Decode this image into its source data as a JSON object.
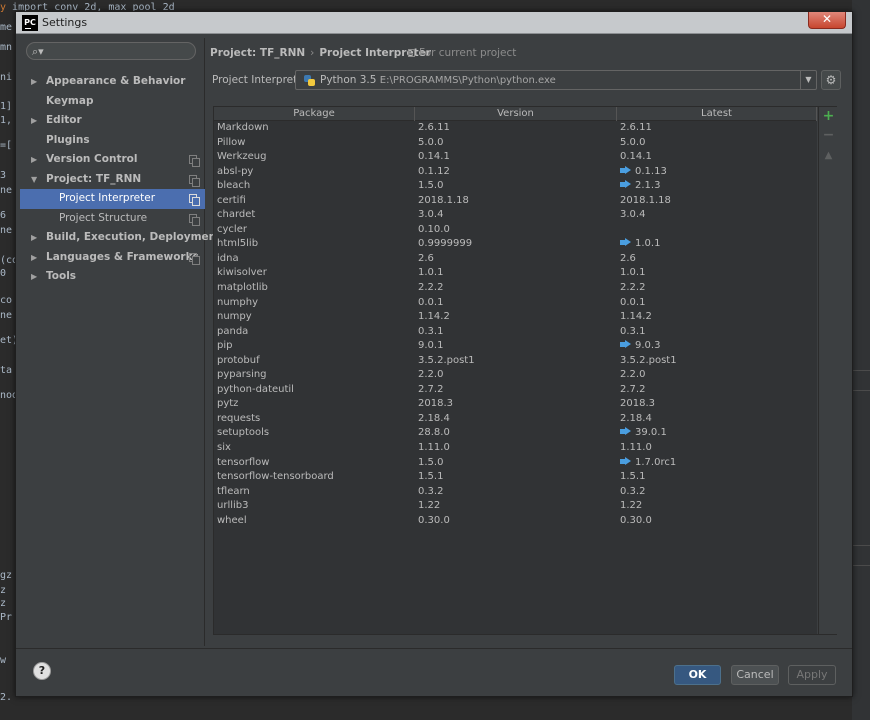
{
  "window": {
    "title": "Settings",
    "app_icon_text": "PC",
    "close_symbol": "✕"
  },
  "background_code": {
    "lines": [
      {
        "kw": "y",
        "rest": " import conv_2d, max_pool_2d"
      },
      {
        "kw": "",
        "rest": "me"
      },
      {
        "kw": "",
        "rest": "mn"
      },
      {
        "kw": "",
        "rest": "ni"
      },
      {
        "kw": "",
        "rest": "1]"
      },
      {
        "kw": "",
        "rest": "1,"
      },
      {
        "kw": "",
        "rest": "=["
      },
      {
        "kw": "",
        "rest": "3"
      },
      {
        "kw": "",
        "rest": "ne"
      },
      {
        "kw": "",
        "rest": "6"
      },
      {
        "kw": "",
        "rest": "ne"
      },
      {
        "kw": "",
        "rest": "(co"
      },
      {
        "kw": "",
        "rest": "0"
      },
      {
        "kw": "",
        "rest": "co"
      },
      {
        "kw": "",
        "rest": "ne"
      },
      {
        "kw": "",
        "rest": "et)"
      },
      {
        "kw": "",
        "rest": "ta"
      },
      {
        "kw": "",
        "rest": "nod"
      },
      {
        "kw": "",
        "rest": "gz"
      },
      {
        "kw": "",
        "rest": "z"
      },
      {
        "kw": "",
        "rest": "z"
      },
      {
        "kw": "",
        "rest": "Pr"
      },
      {
        "kw": "",
        "rest": "w"
      },
      {
        "kw": "",
        "rest": "2."
      }
    ]
  },
  "sidebar": {
    "search_placeholder": "",
    "search_icon": "search-icon",
    "items": [
      {
        "label": "Appearance & Behavior",
        "arrow": "▶",
        "child": false,
        "selected": false,
        "copy": false
      },
      {
        "label": "Keymap",
        "arrow": "",
        "child": false,
        "selected": false,
        "copy": false
      },
      {
        "label": "Editor",
        "arrow": "▶",
        "child": false,
        "selected": false,
        "copy": false
      },
      {
        "label": "Plugins",
        "arrow": "",
        "child": false,
        "selected": false,
        "copy": false
      },
      {
        "label": "Version Control",
        "arrow": "▶",
        "child": false,
        "selected": false,
        "copy": true
      },
      {
        "label": "Project: TF_RNN",
        "arrow": "▼",
        "child": false,
        "selected": false,
        "copy": true
      },
      {
        "label": "Project Interpreter",
        "arrow": "",
        "child": true,
        "selected": true,
        "copy": true
      },
      {
        "label": "Project Structure",
        "arrow": "",
        "child": true,
        "selected": false,
        "copy": true
      },
      {
        "label": "Build, Execution, Deployment",
        "arrow": "▶",
        "child": false,
        "selected": false,
        "copy": false
      },
      {
        "label": "Languages & Frameworks",
        "arrow": "▶",
        "child": false,
        "selected": false,
        "copy": true
      },
      {
        "label": "Tools",
        "arrow": "▶",
        "child": false,
        "selected": false,
        "copy": false
      }
    ]
  },
  "breadcrumb": {
    "project": "Project: TF_RNN",
    "separator": "›",
    "page": "Project Interpreter",
    "scope": "For current project"
  },
  "interpreter": {
    "label": "Project Interpreter:",
    "name": "Python 3.5",
    "path": "E:\\PROGRAMMS\\Python\\python.exe",
    "dropdown_symbol": "▼",
    "gear_symbol": "⚙"
  },
  "table": {
    "columns": [
      "Package",
      "Version",
      "Latest"
    ],
    "rows": [
      {
        "package": "Markdown",
        "version": "2.6.11",
        "latest": "2.6.11",
        "upgrade": false
      },
      {
        "package": "Pillow",
        "version": "5.0.0",
        "latest": "5.0.0",
        "upgrade": false
      },
      {
        "package": "Werkzeug",
        "version": "0.14.1",
        "latest": "0.14.1",
        "upgrade": false
      },
      {
        "package": "absl-py",
        "version": "0.1.12",
        "latest": "0.1.13",
        "upgrade": true
      },
      {
        "package": "bleach",
        "version": "1.5.0",
        "latest": "2.1.3",
        "upgrade": true
      },
      {
        "package": "certifi",
        "version": "2018.1.18",
        "latest": "2018.1.18",
        "upgrade": false
      },
      {
        "package": "chardet",
        "version": "3.0.4",
        "latest": "3.0.4",
        "upgrade": false
      },
      {
        "package": "cycler",
        "version": "0.10.0",
        "latest": "",
        "upgrade": false
      },
      {
        "package": "html5lib",
        "version": "0.9999999",
        "latest": "1.0.1",
        "upgrade": true
      },
      {
        "package": "idna",
        "version": "2.6",
        "latest": "2.6",
        "upgrade": false
      },
      {
        "package": "kiwisolver",
        "version": "1.0.1",
        "latest": "1.0.1",
        "upgrade": false
      },
      {
        "package": "matplotlib",
        "version": "2.2.2",
        "latest": "2.2.2",
        "upgrade": false
      },
      {
        "package": "numphy",
        "version": "0.0.1",
        "latest": "0.0.1",
        "upgrade": false
      },
      {
        "package": "numpy",
        "version": "1.14.2",
        "latest": "1.14.2",
        "upgrade": false
      },
      {
        "package": "panda",
        "version": "0.3.1",
        "latest": "0.3.1",
        "upgrade": false
      },
      {
        "package": "pip",
        "version": "9.0.1",
        "latest": "9.0.3",
        "upgrade": true
      },
      {
        "package": "protobuf",
        "version": "3.5.2.post1",
        "latest": "3.5.2.post1",
        "upgrade": false
      },
      {
        "package": "pyparsing",
        "version": "2.2.0",
        "latest": "2.2.0",
        "upgrade": false
      },
      {
        "package": "python-dateutil",
        "version": "2.7.2",
        "latest": "2.7.2",
        "upgrade": false
      },
      {
        "package": "pytz",
        "version": "2018.3",
        "latest": "2018.3",
        "upgrade": false
      },
      {
        "package": "requests",
        "version": "2.18.4",
        "latest": "2.18.4",
        "upgrade": false
      },
      {
        "package": "setuptools",
        "version": "28.8.0",
        "latest": "39.0.1",
        "upgrade": true
      },
      {
        "package": "six",
        "version": "1.11.0",
        "latest": "1.11.0",
        "upgrade": false
      },
      {
        "package": "tensorflow",
        "version": "1.5.0",
        "latest": "1.7.0rc1",
        "upgrade": true
      },
      {
        "package": "tensorflow-tensorboard",
        "version": "1.5.1",
        "latest": "1.5.1",
        "upgrade": false
      },
      {
        "package": "tflearn",
        "version": "0.3.2",
        "latest": "0.3.2",
        "upgrade": false
      },
      {
        "package": "urllib3",
        "version": "1.22",
        "latest": "1.22",
        "upgrade": false
      },
      {
        "package": "wheel",
        "version": "0.30.0",
        "latest": "0.30.0",
        "upgrade": false
      }
    ],
    "tools": {
      "add": "+",
      "remove": "−",
      "up": "▲"
    }
  },
  "footer": {
    "help": "?",
    "ok": "OK",
    "cancel": "Cancel",
    "apply": "Apply"
  },
  "colors": {
    "selection": "#4b6eaf",
    "upgrade_arrow": "#4a9ee0",
    "add_tool": "#4caf50",
    "ok_button": "#365880"
  }
}
